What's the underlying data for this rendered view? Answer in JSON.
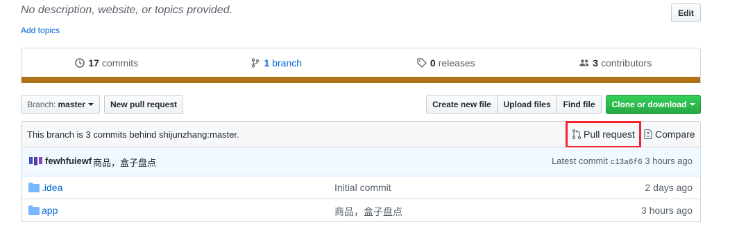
{
  "repo": {
    "description": "No description, website, or topics provided.",
    "add_topics": "Add topics",
    "edit_label": "Edit"
  },
  "summary": {
    "commits_count": "17",
    "commits_label": "commits",
    "branch_count": "1",
    "branch_label": "branch",
    "releases_count": "0",
    "releases_label": "releases",
    "contributors_count": "3",
    "contributors_label": "contributors",
    "language_color": "#b07219"
  },
  "toolbar": {
    "branch_prefix": "Branch:",
    "branch_name": "master",
    "new_pull_request": "New pull request",
    "create_new_file": "Create new file",
    "upload_files": "Upload files",
    "find_file": "Find file",
    "clone_or_download": "Clone or download"
  },
  "branch_status": {
    "text": "This branch is 3 commits behind shijunzhang:master.",
    "pull_request": "Pull request",
    "compare": "Compare",
    "highlight_color": "#f5222d"
  },
  "latest_commit": {
    "author": "fewhfuiewf",
    "message": "商品，盒子盘点",
    "prefix": "Latest commit",
    "sha": "c13a6f6",
    "age": "3 hours ago"
  },
  "files": [
    {
      "name": ".idea",
      "message": "Initial commit",
      "age": "2 days ago",
      "type": "folder"
    },
    {
      "name": "app",
      "message": "商品，盒子盘点",
      "age": "3 hours ago",
      "type": "folder"
    }
  ]
}
